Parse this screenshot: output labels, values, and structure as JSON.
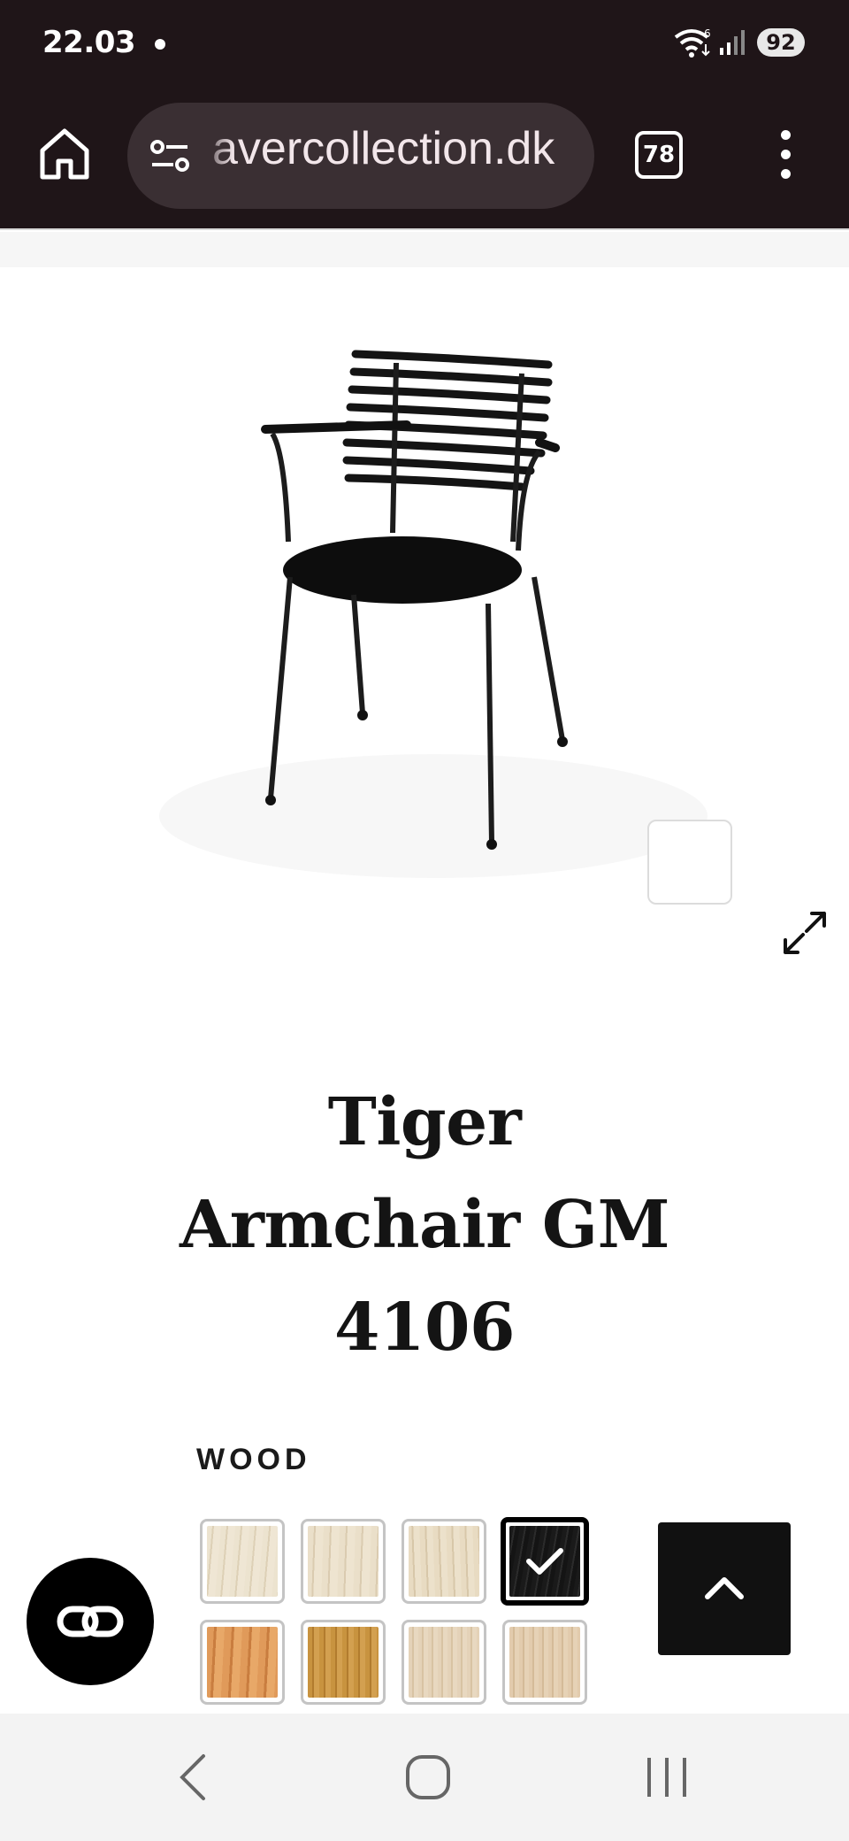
{
  "status_bar": {
    "time": "22.03",
    "battery": "92",
    "network_badge": "6"
  },
  "browser": {
    "url": "avercollection.dk",
    "tab_count": "78"
  },
  "product": {
    "title_line_1": "Tiger",
    "title_line_2": "Armchair GM",
    "title_line_3": "4106"
  },
  "options": {
    "wood_label": "WOOD",
    "swatches": [
      {
        "name": "light-birch-1",
        "color": "#e8dcc5",
        "selected": false
      },
      {
        "name": "light-birch-2",
        "color": "#e6d9c1",
        "selected": false
      },
      {
        "name": "light-birch-3",
        "color": "#e4d6bc",
        "selected": false
      },
      {
        "name": "black",
        "color": "#1a1a1a",
        "selected": true
      },
      {
        "name": "cherry",
        "color": "#d9904f",
        "selected": false
      },
      {
        "name": "oak",
        "color": "#c48f3d",
        "selected": false
      },
      {
        "name": "light-oak-1",
        "color": "#e2cfb4",
        "selected": false
      },
      {
        "name": "light-oak-2",
        "color": "#dfc8aa",
        "selected": false
      }
    ]
  },
  "colors": {
    "browser_bg": "#1f1518",
    "accent_dark": "#111111"
  }
}
